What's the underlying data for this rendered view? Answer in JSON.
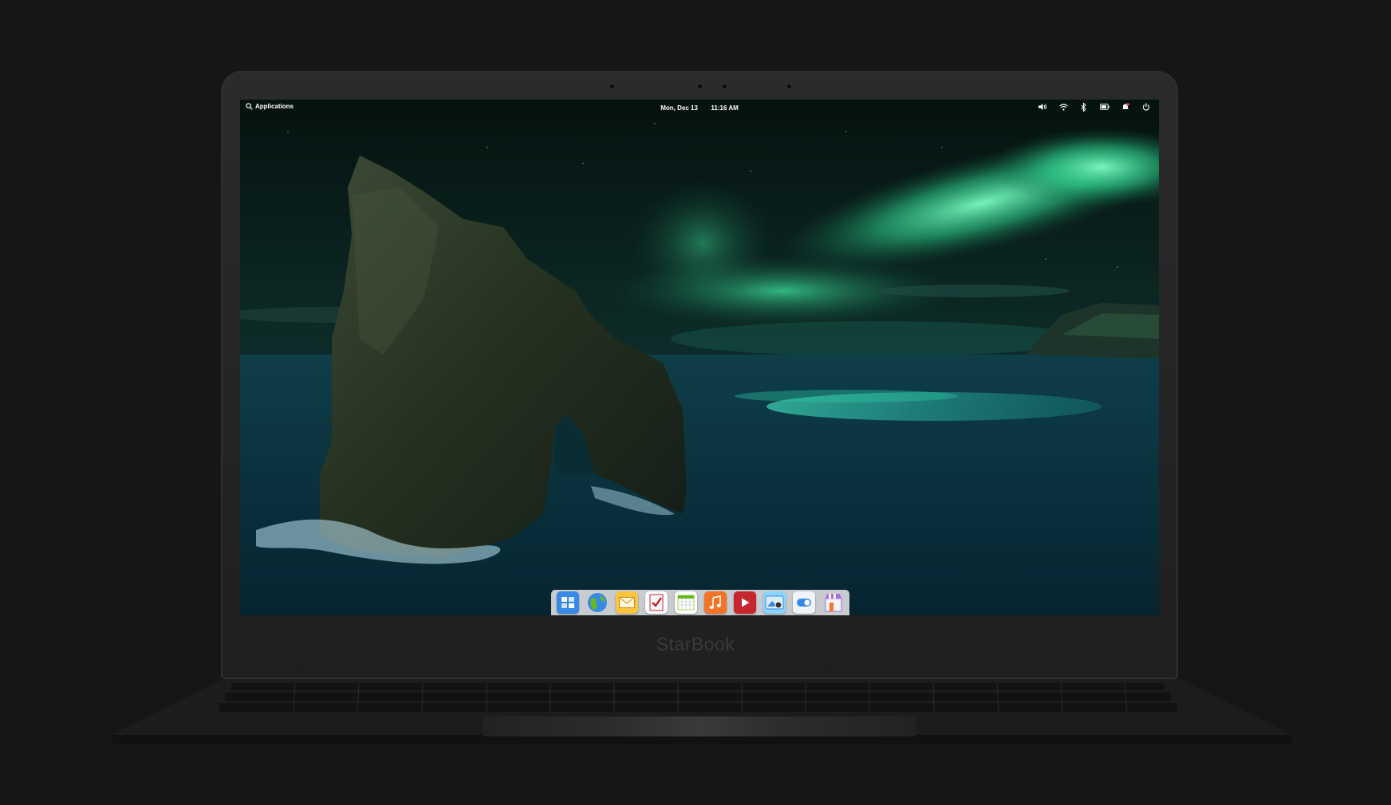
{
  "device": {
    "brand": "StarBook"
  },
  "panel": {
    "applications_label": "Applications",
    "date": "Mon, Dec 13",
    "time": "11:16 AM",
    "tray": [
      {
        "name": "volume-icon"
      },
      {
        "name": "wifi-icon"
      },
      {
        "name": "bluetooth-icon"
      },
      {
        "name": "battery-icon"
      },
      {
        "name": "notifications-icon"
      },
      {
        "name": "power-icon"
      }
    ]
  },
  "dock": {
    "items": [
      {
        "name": "multitasking-view-icon",
        "color": "#3689e6"
      },
      {
        "name": "web-browser-icon",
        "color": "#68b723"
      },
      {
        "name": "mail-icon",
        "color": "#f9c440"
      },
      {
        "name": "tasks-icon",
        "color": "#ffffff"
      },
      {
        "name": "calendar-icon",
        "color": "#ffffff"
      },
      {
        "name": "music-icon",
        "color": "#f37329"
      },
      {
        "name": "videos-icon",
        "color": "#c6262e"
      },
      {
        "name": "photos-icon",
        "color": "#8cd5ff"
      },
      {
        "name": "system-settings-icon",
        "color": "#a3b4c4"
      },
      {
        "name": "appcenter-icon",
        "color": "#a56de2"
      }
    ]
  },
  "colors": {
    "aurora": "#3de8a0",
    "sea": "#0b3a44",
    "dock_bg": "#e4e4e4",
    "bezel": "#262626",
    "background": "#161616"
  }
}
